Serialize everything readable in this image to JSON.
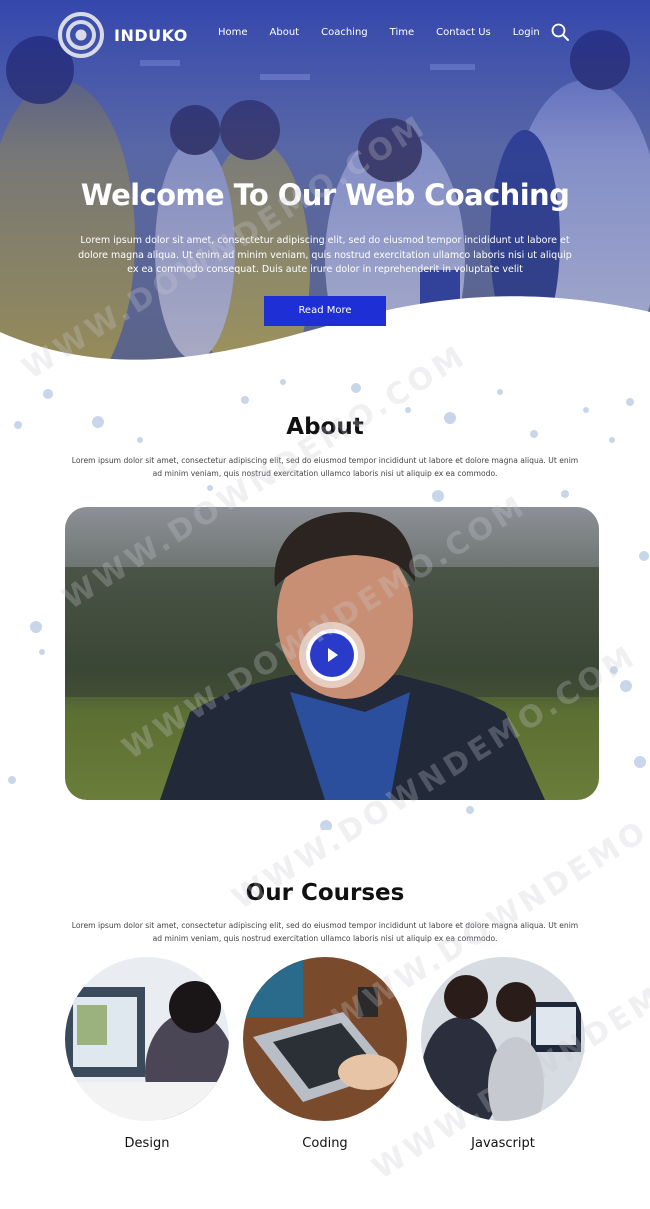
{
  "brand": {
    "name": "INDUKO"
  },
  "nav": {
    "items": [
      "Home",
      "About",
      "Coaching",
      "Time",
      "Contact Us",
      "Login"
    ],
    "search_icon": "search-icon"
  },
  "hero": {
    "title": "Welcome To Our Web Coaching",
    "text": "Lorem ipsum dolor sit amet, consectetur adipiscing elit, sed do eiusmod tempor incididunt ut labore et dolore magna aliqua. Ut enim ad minim veniam, quis nostrud exercitation ullamco laboris nisi ut aliquip ex ea commodo consequat. Duis aute irure dolor in reprehenderit in voluptate velit",
    "button": "Read More"
  },
  "about": {
    "title": "About",
    "text": "Lorem ipsum dolor sit amet, consectetur adipiscing elit, sed do eiusmod tempor incididunt ut labore et dolore magna aliqua. Ut enim ad minim veniam, quis nostrud exercitation ullamco laboris nisi ut aliquip ex ea commodo.",
    "video_play_icon": "play-icon"
  },
  "courses": {
    "title": "Our Courses",
    "text": "Lorem ipsum dolor sit amet, consectetur adipiscing elit, sed do eiusmod tempor incididunt ut labore et dolore magna aliqua. Ut enim ad minim veniam, quis nostrud exercitation ullamco laboris nisi ut aliquip ex ea commodo.",
    "items": [
      {
        "label": "Design"
      },
      {
        "label": "Coding"
      },
      {
        "label": "Javascript"
      }
    ]
  },
  "watermark": "WWW.DOWNDEMO.COM",
  "colors": {
    "primary": "#1f2fd6",
    "hero_tint": "#2a3a9a",
    "text": "#111111",
    "dots": "#c8d6ea"
  }
}
